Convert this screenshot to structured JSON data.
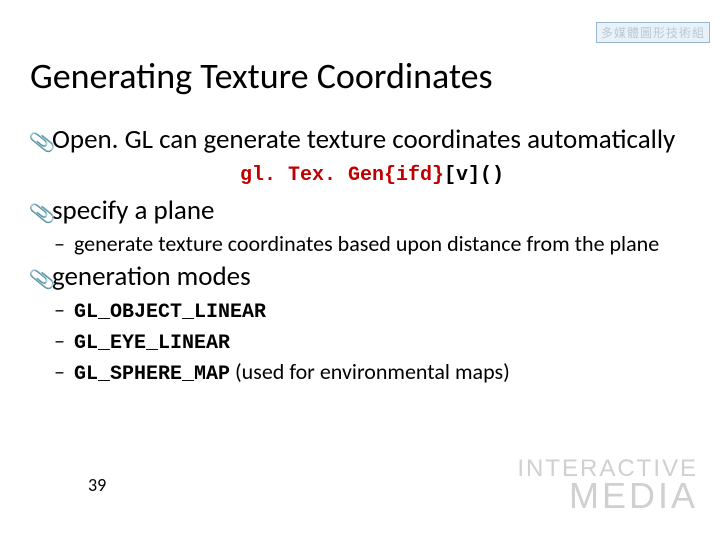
{
  "badge": "多媒體圖形技術組",
  "title": "Generating Texture Coordinates",
  "bullet1": "Open. GL can generate texture coordinates automatically",
  "code_fn": "gl. Tex. Gen{ifd}",
  "code_args": "[v]()",
  "bullet2": "specify a plane",
  "bullet2_sub1": "generate texture coordinates based upon distance from the plane",
  "bullet3": "generation modes",
  "mode1": "GL_OBJECT_LINEAR",
  "mode2": "GL_EYE_LINEAR",
  "mode3": "GL_SPHERE_MAP",
  "mode3_annot": "  (used for environmental maps)",
  "pagenum": "39",
  "media_line1": "INTERACTIVE",
  "media_line2": "MEDIA"
}
